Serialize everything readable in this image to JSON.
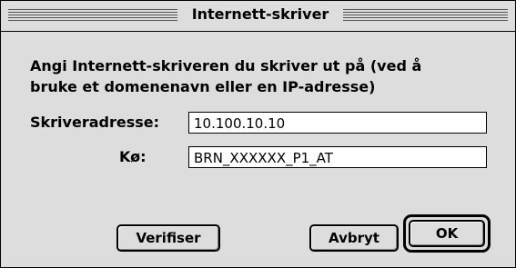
{
  "dialog": {
    "title": "Internett-skriver",
    "prompt": "Angi Internett-skriveren du skriver ut på (ved å\nbruke et domenenavn eller en IP-adresse)",
    "address_label": "Skriveradresse:",
    "address_value": "10.100.10.10",
    "queue_label": "Kø:",
    "queue_value": "BRN_XXXXXX_P1_AT",
    "verify_label": "Verifiser",
    "cancel_label": "Avbryt",
    "ok_label": "OK"
  }
}
